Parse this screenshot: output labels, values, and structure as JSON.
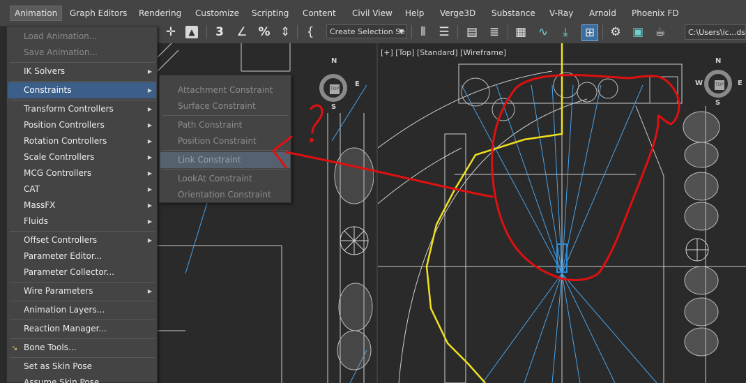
{
  "menubar": {
    "items": [
      "Animation",
      "Graph Editors",
      "Rendering",
      "Customize",
      "Scripting",
      "Content",
      "Civil View",
      "Help",
      "Verge3D",
      "Substance",
      "V-Ray",
      "Arnold",
      "Phoenix FD"
    ],
    "active_index": 0
  },
  "toolbar": {
    "selection_set_placeholder": "Create Selection Se",
    "path_text": "C:\\Users\\ic...ds M"
  },
  "viewport_right": {
    "label": "[+] [Top] [Standard] [Wireframe]",
    "compass": {
      "n": "N",
      "s": "S",
      "e": "E",
      "w": "W"
    },
    "cube_label": "TOP"
  },
  "viewport_left": {
    "compass": {
      "n": "N",
      "s": "S",
      "e": "E"
    },
    "cube_label": "TOP"
  },
  "animation_menu": {
    "items": [
      {
        "label": "Load Animation...",
        "disabled": true
      },
      {
        "label": "Save Animation...",
        "disabled": true
      },
      {
        "label": "IK Solvers",
        "submenu": true
      },
      {
        "label": "Constraints",
        "submenu": true,
        "highlighted": true
      },
      {
        "label": "Transform Controllers",
        "submenu": true
      },
      {
        "label": "Position Controllers",
        "submenu": true
      },
      {
        "label": "Rotation Controllers",
        "submenu": true
      },
      {
        "label": "Scale Controllers",
        "submenu": true
      },
      {
        "label": "MCG Controllers",
        "submenu": true
      },
      {
        "label": "CAT",
        "submenu": true
      },
      {
        "label": "MassFX",
        "submenu": true
      },
      {
        "label": "Fluids",
        "submenu": true
      },
      {
        "label": "Offset Controllers",
        "submenu": true
      },
      {
        "label": "Parameter Editor..."
      },
      {
        "label": "Parameter Collector..."
      },
      {
        "label": "Wire Parameters",
        "submenu": true
      },
      {
        "label": "Animation Layers..."
      },
      {
        "label": "Reaction Manager..."
      },
      {
        "label": "Bone Tools..."
      },
      {
        "label": "Set as Skin Pose"
      },
      {
        "label": "Assume Skin Pose"
      }
    ]
  },
  "constraints_submenu": {
    "items": [
      {
        "label": "Attachment Constraint",
        "disabled": true
      },
      {
        "label": "Surface Constraint",
        "disabled": true
      },
      {
        "label": "Path Constraint",
        "disabled": true
      },
      {
        "label": "Position Constraint",
        "disabled": true
      },
      {
        "label": "Link Constraint",
        "disabled": true,
        "highlighted": true
      },
      {
        "label": "LookAt Constraint",
        "disabled": true
      },
      {
        "label": "Orientation Constraint",
        "disabled": true
      }
    ]
  },
  "icons": [
    "move-icon",
    "select-icon",
    "snap-3d-icon",
    "angle-snap-icon",
    "percent-snap-icon",
    "spinner-snap-icon",
    "edit-named-selection-icon",
    "mirror-icon",
    "align-icon",
    "scene-explorer-icon",
    "layer-explorer-icon",
    "ribbon-icon",
    "curve-editor-icon",
    "dope-sheet-icon",
    "schematic-view-icon",
    "render-setup-icon",
    "render-frame-icon",
    "render-icon",
    "teapot-icon"
  ],
  "annotation_color": "#e01010",
  "spline_color": "#f0e020",
  "highlight_color": "#3c5f8a"
}
